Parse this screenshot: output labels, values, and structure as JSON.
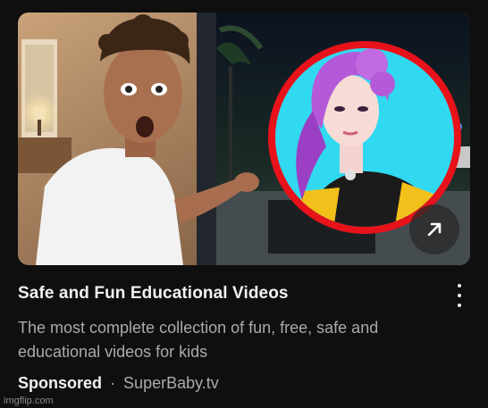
{
  "ad": {
    "title": "Safe and Fun Educational Videos",
    "description": "The most complete collection of fun, free, safe and educational videos for kids",
    "sponsored_label": "Sponsored",
    "separator": "·",
    "advertiser": "SuperBaby.tv"
  },
  "thumbnail": {
    "icons": {
      "open": "arrow-up-right-icon",
      "menu": "more-vertical-icon"
    },
    "colors": {
      "ring": "#e8121a",
      "avatar_bg": "#30d9f0",
      "hair": "#b45ad8"
    }
  },
  "watermark": "imgflip.com"
}
